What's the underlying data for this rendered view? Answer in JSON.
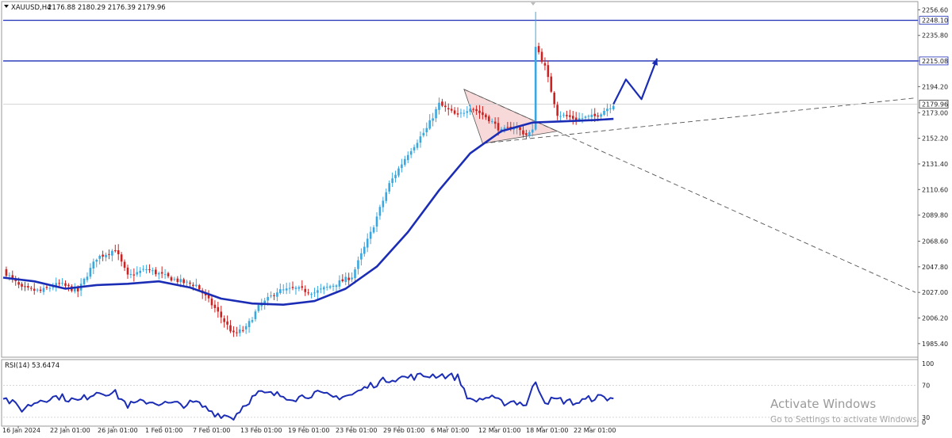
{
  "header": {
    "symbol": "XAUUSD,H4",
    "ohlc": "2176.88 2180.29 2176.39 2179.96"
  },
  "rsi_header": "RSI(14) 53.6474",
  "watermark": {
    "title": "Activate Windows",
    "subtitle": "Go to Settings to activate Windows."
  },
  "colors": {
    "bull": "#3aa8e0",
    "bear": "#cc2222",
    "ma": "#1b2db5",
    "levels": "#1b2db5",
    "triangle_fill": "#f7d2d2",
    "dashed": "#555555",
    "rsi": "#1b2db5"
  },
  "chart_data": [
    {
      "type": "candlestick",
      "instrument": "XAUUSD",
      "timeframe": "H4",
      "ylim": [
        1975,
        2262
      ],
      "y_ticks": [
        "2256.60",
        "2235.80",
        "2215.08",
        "2194.20",
        "2173.00",
        "2152.20",
        "2131.40",
        "2110.60",
        "2089.80",
        "2068.60",
        "2047.80",
        "2027.00",
        "2006.20",
        "1985.40"
      ],
      "x_ticks": [
        "16 Jan 2024",
        "22 Jan 01:00",
        "26 Jan 01:00",
        "1 Feb 01:00",
        "7 Feb 01:00",
        "13 Feb 01:00",
        "19 Feb 01:00",
        "23 Feb 01:00",
        "29 Feb 01:00",
        "6 Mar 01:00",
        "12 Mar 01:00",
        "18 Mar 01:00",
        "22 Mar 01:00"
      ],
      "horizontal_levels": [
        "2248.10",
        "2215.08"
      ],
      "current_price": "2179.96",
      "close_path": [
        [
          0,
          2045
        ],
        [
          6,
          2030
        ],
        [
          12,
          2028
        ],
        [
          18,
          2034
        ],
        [
          24,
          2028
        ],
        [
          30,
          2055
        ],
        [
          36,
          2062
        ],
        [
          40,
          2040
        ],
        [
          46,
          2046
        ],
        [
          52,
          2040
        ],
        [
          58,
          2035
        ],
        [
          62,
          2033
        ],
        [
          68,
          2014
        ],
        [
          74,
          1993
        ],
        [
          78,
          1998
        ],
        [
          82,
          2015
        ],
        [
          88,
          2028
        ],
        [
          94,
          2030
        ],
        [
          100,
          2027
        ],
        [
          106,
          2033
        ],
        [
          112,
          2040
        ],
        [
          118,
          2075
        ],
        [
          124,
          2115
        ],
        [
          130,
          2140
        ],
        [
          136,
          2160
        ],
        [
          140,
          2180
        ],
        [
          146,
          2170
        ],
        [
          150,
          2178
        ],
        [
          156,
          2168
        ],
        [
          160,
          2158
        ],
        [
          164,
          2162
        ],
        [
          168,
          2155
        ],
        [
          170,
          2158
        ],
        [
          171,
          2228
        ],
        [
          174,
          2210
        ],
        [
          178,
          2172
        ],
        [
          184,
          2168
        ],
        [
          190,
          2170
        ],
        [
          196,
          2180
        ]
      ],
      "moving_average": [
        [
          0,
          2039
        ],
        [
          10,
          2036
        ],
        [
          20,
          2030
        ],
        [
          30,
          2033
        ],
        [
          40,
          2034
        ],
        [
          50,
          2036
        ],
        [
          60,
          2031
        ],
        [
          70,
          2022
        ],
        [
          80,
          2018
        ],
        [
          90,
          2017
        ],
        [
          100,
          2020
        ],
        [
          110,
          2030
        ],
        [
          120,
          2048
        ],
        [
          130,
          2076
        ],
        [
          140,
          2110
        ],
        [
          150,
          2140
        ],
        [
          160,
          2158
        ],
        [
          170,
          2165
        ],
        [
          180,
          2166
        ],
        [
          190,
          2167
        ],
        [
          196,
          2168
        ]
      ],
      "projection": [
        [
          196,
          2180
        ],
        [
          200,
          2200
        ],
        [
          205,
          2184
        ],
        [
          210,
          2217
        ]
      ],
      "triangle_pattern": [
        [
          148,
          2192
        ],
        [
          178,
          2158
        ],
        [
          154,
          2148
        ]
      ],
      "trendlines": [
        {
          "from": [
            148,
            2192
          ],
          "to": [
            293,
            2027
          ]
        },
        {
          "from": [
            154,
            2148
          ],
          "to": [
            293,
            2185
          ]
        }
      ]
    },
    {
      "type": "line",
      "name": "RSI(14)",
      "value": 53.6474,
      "ylim": [
        20,
        100
      ],
      "y_ticks": [
        "100",
        "70",
        "30",
        "0"
      ],
      "levels": [
        70,
        30
      ],
      "x": [
        0,
        6,
        12,
        18,
        24,
        30,
        36,
        40,
        46,
        52,
        58,
        62,
        68,
        74,
        78,
        82,
        88,
        94,
        100,
        106,
        112,
        118,
        124,
        130,
        136,
        140,
        146,
        150,
        156,
        160,
        164,
        168,
        171,
        174,
        178,
        184,
        190,
        196
      ],
      "values": [
        55,
        40,
        52,
        56,
        50,
        62,
        60,
        45,
        50,
        47,
        46,
        48,
        35,
        30,
        48,
        60,
        58,
        54,
        60,
        55,
        58,
        70,
        78,
        80,
        82,
        83,
        80,
        50,
        55,
        48,
        50,
        46,
        75,
        50,
        52,
        48,
        55,
        54
      ]
    }
  ]
}
